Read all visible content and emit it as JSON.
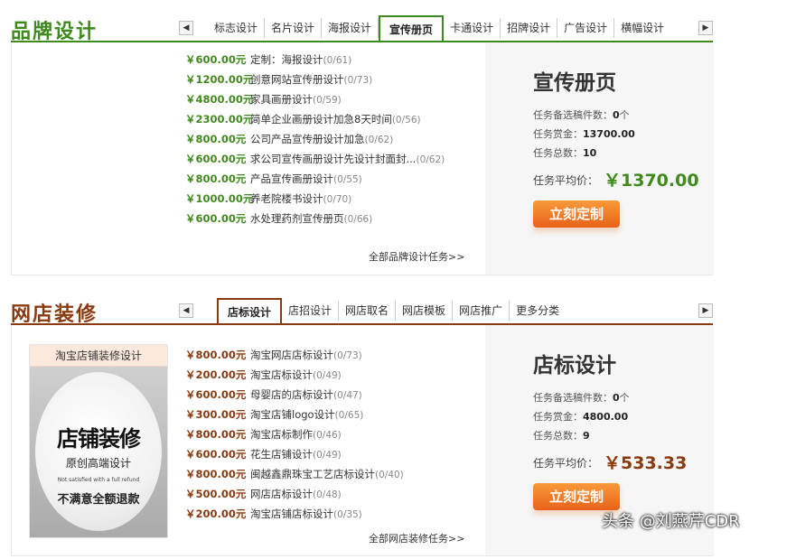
{
  "brand": {
    "title": "品牌设计",
    "color": "#3f8a1c",
    "tabs": [
      "标志设计",
      "名片设计",
      "海报设计",
      "宣传册页",
      "卡通设计",
      "招牌设计",
      "广告设计",
      "横幅设计"
    ],
    "active_tab": "宣传册页",
    "tasks": [
      {
        "price": "￥600.00元",
        "name": "定制：海报设计",
        "count": "(0/61)"
      },
      {
        "price": "￥1200.00元",
        "name": "创意网站宣传册设计",
        "count": "(0/73)"
      },
      {
        "price": "￥4800.00元",
        "name": "家具画册设计",
        "count": "(0/59)"
      },
      {
        "price": "￥2300.00元",
        "name": "简单企业画册设计加急8天时间",
        "count": "(0/56)"
      },
      {
        "price": "￥800.00元",
        "name": "公司产品宣传册设计加急",
        "count": "(0/62)"
      },
      {
        "price": "￥600.00元",
        "name": "求公司宣传画册设计先设计封面封...",
        "count": "(0/62)"
      },
      {
        "price": "￥800.00元",
        "name": "产品宣传画册设计",
        "count": "(0/55)"
      },
      {
        "price": "￥1000.00元",
        "name": "养老院楼书设计",
        "count": "(0/70)"
      },
      {
        "price": "￥600.00元",
        "name": "水处理药剂宣传册页",
        "count": "(0/66)"
      }
    ],
    "more": "全部品牌设计任务>>",
    "info": {
      "heading": "宣传册页",
      "candidates_label": "任务备选稿件数：",
      "candidates": "0",
      "candidates_unit": "个",
      "reward_label": "任务赏金：",
      "reward": "13700.00",
      "total_label": "任务总数：",
      "total": "10",
      "avg_label": "任务平均价：",
      "avg": "￥1370.00",
      "button": "立刻定制"
    }
  },
  "shop": {
    "title": "网店装修",
    "color": "#8b3a0f",
    "tabs": [
      "店标设计",
      "店招设计",
      "网店取名",
      "网店模板",
      "网店推广",
      "更多分类"
    ],
    "active_tab": "店标设计",
    "image_caption": "淘宝店铺装修设计",
    "image_text": {
      "main": "店铺装修",
      "sub": "原创高端设计",
      "english": "Not satisfied with a full refund",
      "refund": "不满意全额退款"
    },
    "tasks": [
      {
        "price": "￥800.00元",
        "name": "淘宝网店店标设计",
        "count": "(0/73)"
      },
      {
        "price": "￥200.00元",
        "name": "淘宝店标设计",
        "count": "(0/49)"
      },
      {
        "price": "￥600.00元",
        "name": "母婴店的店标设计",
        "count": "(0/47)"
      },
      {
        "price": "￥300.00元",
        "name": "淘宝店铺logo设计",
        "count": "(0/65)"
      },
      {
        "price": "￥800.00元",
        "name": "淘宝店标制作",
        "count": "(0/46)"
      },
      {
        "price": "￥600.00元",
        "name": "花生店铺设计",
        "count": "(0/49)"
      },
      {
        "price": "￥800.00元",
        "name": "闽越鑫鼎珠宝工艺店标设计",
        "count": "(0/40)"
      },
      {
        "price": "￥500.00元",
        "name": "网店店标设计",
        "count": "(0/48)"
      },
      {
        "price": "￥200.00元",
        "name": "淘宝店铺店标设计",
        "count": "(0/35)"
      }
    ],
    "more": "全部网店装修任务>>",
    "info": {
      "heading": "店标设计",
      "candidates_label": "任务备选稿件数：",
      "candidates": "0",
      "candidates_unit": "个",
      "reward_label": "任务赏金：",
      "reward": "4800.00",
      "total_label": "任务总数：",
      "total": "9",
      "avg_label": "任务平均价：",
      "avg": "￥533.33",
      "button": "立刻定制"
    }
  },
  "arrows": {
    "left": "◀",
    "right": "▶"
  },
  "watermark": "头条 @刘燕芹CDR"
}
